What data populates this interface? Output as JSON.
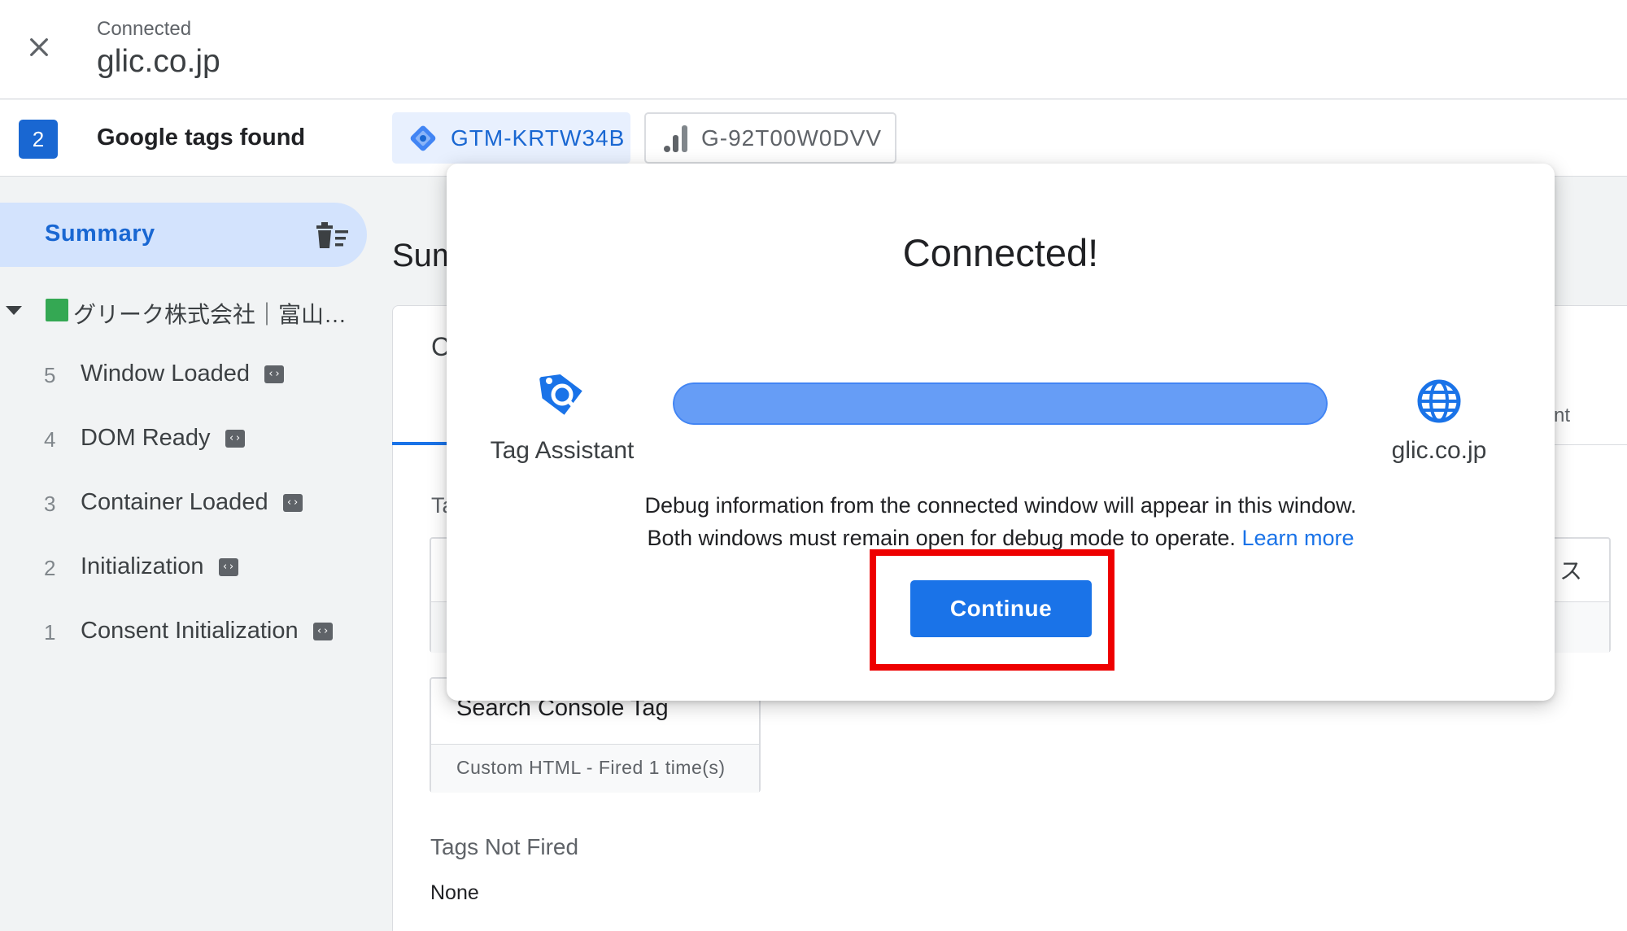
{
  "header": {
    "status": "Connected",
    "site": "glic.co.jp"
  },
  "tags_bar": {
    "count": "2",
    "label": "Google tags found",
    "chips": [
      {
        "id": "GTM-KRTW34B",
        "icon": "gtm-diamond-icon"
      },
      {
        "id": "G-92T00W0DVV",
        "icon": "analytics-bars-icon"
      }
    ]
  },
  "sidebar": {
    "summary": "Summary",
    "page_title": "グリーク株式会社｜富山…",
    "events": [
      {
        "num": "5",
        "label": "Window Loaded"
      },
      {
        "num": "4",
        "label": "DOM Ready"
      },
      {
        "num": "3",
        "label": "Container Loaded"
      },
      {
        "num": "2",
        "label": "Initialization"
      },
      {
        "num": "1",
        "label": "Consent Initialization"
      }
    ]
  },
  "main": {
    "title_fragment": "Sum",
    "tab_fragment": "C",
    "right_fragment": "nt",
    "section_fragment": "Ta",
    "right_jp_fragment": "ス",
    "tag_card": {
      "name": "Search Console Tag",
      "meta": "Custom HTML - Fired 1 time(s)"
    },
    "not_fired_heading": "Tags Not Fired",
    "not_fired_value": "None"
  },
  "modal": {
    "title": "Connected!",
    "left_label": "Tag Assistant",
    "right_label": "glic.co.jp",
    "progress": 1.0,
    "desc_line1": "Debug information from the connected window will appear in this window.",
    "desc_line2": "Both windows must remain open for debug mode to operate.",
    "learn_more": "Learn more",
    "continue": "Continue"
  },
  "colors": {
    "accent": "#1a73e8",
    "highlight": "#ee0000",
    "progress": "#669df6"
  }
}
